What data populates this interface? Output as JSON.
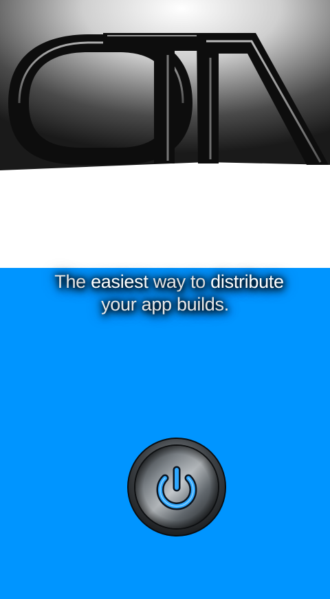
{
  "app": {
    "logo_text": "OTA"
  },
  "tagline": {
    "line1_part1": "The",
    "line1_part2": "easiest",
    "line1_part3": "way to",
    "line1_part4": "distribute",
    "line2": "your app builds."
  },
  "colors": {
    "background_top": "#ffffff",
    "background_bottom": "#0095ff",
    "logo_dark": "#111111",
    "power_glow": "#2fa8ff"
  },
  "icons": {
    "power": "power-icon"
  }
}
